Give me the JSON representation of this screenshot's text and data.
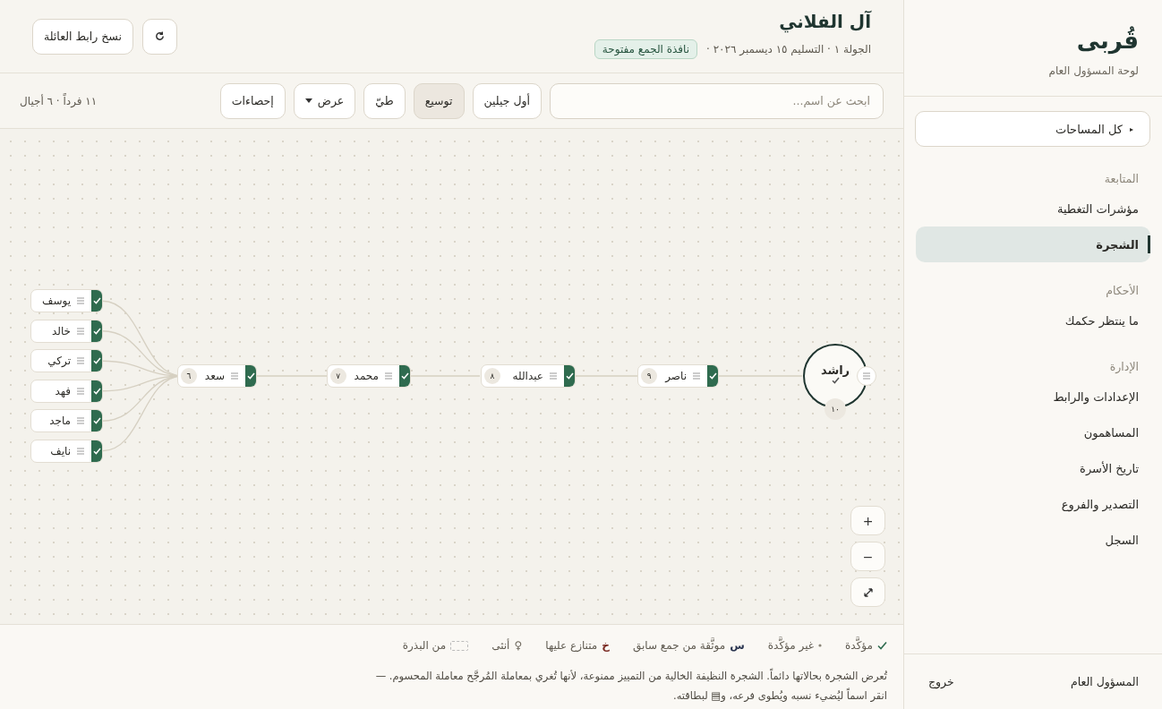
{
  "sidebar": {
    "logo": "قُربى",
    "subtitle": "لوحة المسؤول العام",
    "space_selector": {
      "caret": "▸",
      "label": "كل المساحات"
    },
    "sections": [
      {
        "title": "المتابعة",
        "items": [
          {
            "label": "مؤشرات التغطية",
            "selected": false
          },
          {
            "label": "الشجرة",
            "selected": true
          }
        ]
      },
      {
        "title": "الأحكام",
        "items": [
          {
            "label": "ما ينتظر حكمك",
            "selected": false
          }
        ]
      },
      {
        "title": "الإدارة",
        "items": [
          {
            "label": "الإعدادات والرابط",
            "selected": false
          },
          {
            "label": "المساهمون",
            "selected": false
          },
          {
            "label": "تاريخ الأسرة",
            "selected": false
          },
          {
            "label": "التصدير والفروع",
            "selected": false
          },
          {
            "label": "السجل",
            "selected": false
          }
        ]
      }
    ],
    "user": "المسؤول العام",
    "logout": "خروج"
  },
  "header": {
    "title": "آل الفلاني",
    "meta": "الجولة ١ · التسليم ١٥ ديسمبر ٢٠٢٦ ·",
    "status_badge": "نافذة الجمع مفتوحة",
    "copy_button": "نسخ رابط العائلة"
  },
  "toolbar": {
    "search": {
      "placeholder": "ابحث عن اسم..."
    },
    "buttons": [
      {
        "label": "أول جيلين",
        "selected": false,
        "kind": "plain"
      },
      {
        "label": "توسيع",
        "selected": true,
        "kind": "plain"
      },
      {
        "label": "طيّ",
        "selected": false,
        "kind": "plain"
      },
      {
        "label": "عرض",
        "selected": false,
        "kind": "dropdown"
      },
      {
        "label": "إحصاءات",
        "selected": false,
        "kind": "plain"
      }
    ],
    "summary": "١١ فرداً · ٦ أجيال"
  },
  "tree": {
    "root": {
      "name": "راشد",
      "count": "١٠",
      "confirmed": true,
      "children": [
        {
          "name": "ناصر",
          "count": "٩",
          "confirmed": true,
          "children": [
            {
              "name": "عبدالله",
              "count": "٨",
              "confirmed": true,
              "children": [
                {
                  "name": "محمد",
                  "count": "٧",
                  "confirmed": true,
                  "children": [
                    {
                      "name": "سعد",
                      "count": "٦",
                      "confirmed": true,
                      "children": [
                        {
                          "name": "يوسف",
                          "confirmed": true
                        },
                        {
                          "name": "خالد",
                          "confirmed": true
                        },
                        {
                          "name": "تركي",
                          "confirmed": true
                        },
                        {
                          "name": "فهد",
                          "confirmed": true
                        },
                        {
                          "name": "ماجد",
                          "confirmed": true
                        },
                        {
                          "name": "نايف",
                          "confirmed": true
                        }
                      ]
                    }
                  ]
                }
              ]
            }
          ]
        }
      ]
    }
  },
  "zoom_controls": [
    "+",
    "−"
  ],
  "legend": [
    {
      "kind": "check",
      "label": "مؤكَّدة"
    },
    {
      "kind": "dot",
      "label": "غير مؤكَّدة"
    },
    {
      "kind": "symbol",
      "symbol": "س",
      "label": "موثَّقة من جمع سابق",
      "color": "#2a3550"
    },
    {
      "kind": "symbol",
      "symbol": "خ",
      "label": "متنازع عليها",
      "color": "#7a2a22"
    },
    {
      "kind": "symbol",
      "symbol": "♀",
      "label": "أنثى",
      "color": "#6b655a"
    },
    {
      "kind": "dashed",
      "label": "من البذرة"
    }
  ],
  "note": "تُعرض الشجرة بحالاتها دائماً. الشجرة النظيفة الخالية من التمييز ممنوعة، لأنها تُغري بمعاملة المُرجَّح معاملة المحسوم. — انقر اسماً ليُضيء نسبه ويُطوى فرعه، و▤ لبطاقته."
}
